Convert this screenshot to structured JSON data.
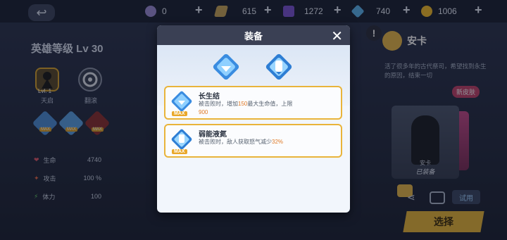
{
  "topbar": {
    "resources": [
      {
        "icon": "purple-orb-icon",
        "value": "0",
        "color": "#9c8cd8"
      },
      {
        "icon": "gold-ticket-icon",
        "value": "615",
        "color": "#c8a75a"
      },
      {
        "icon": "purple-cube-icon",
        "value": "1272",
        "color": "#7a55d6"
      },
      {
        "icon": "blue-crystal-icon",
        "value": "740",
        "color": "#5cb4ee"
      },
      {
        "icon": "gold-coin-icon",
        "value": "1006",
        "color": "#f2bc2a"
      }
    ],
    "plus_label": "+"
  },
  "left": {
    "hero_level": "英雄等级 Lv 30",
    "skills": [
      {
        "level": "Lvl. 1",
        "name": "天启"
      },
      {
        "name": "翻滚"
      }
    ],
    "gem_badges": [
      "MAX",
      "MAX",
      "MAX"
    ],
    "stats": [
      {
        "label": "生命",
        "value": "4740"
      },
      {
        "label": "攻击",
        "value": "100 %"
      },
      {
        "label": "体力",
        "value": "100"
      }
    ]
  },
  "right": {
    "hero_name": "安卡",
    "hero_desc": "活了很多年的古代祭司，希望找到永生的原因，结束一切",
    "new_skin": "新皮肤",
    "card_name": "安卡",
    "card_status": "已装备",
    "try_label": "试用",
    "select_label": "选择"
  },
  "modal": {
    "title": "装备",
    "close": "✕",
    "items": [
      {
        "name": "长生结",
        "desc_pre": "被击败时，增加",
        "desc_hl1": "150",
        "desc_mid": "最大生命值，上限",
        "desc_hl2": "900",
        "badge": "MAX"
      },
      {
        "name": "弱能液氮",
        "desc_pre": "被击败时，敌人获取怒气减少",
        "desc_hl1": "32%",
        "badge": "MAX"
      }
    ]
  }
}
